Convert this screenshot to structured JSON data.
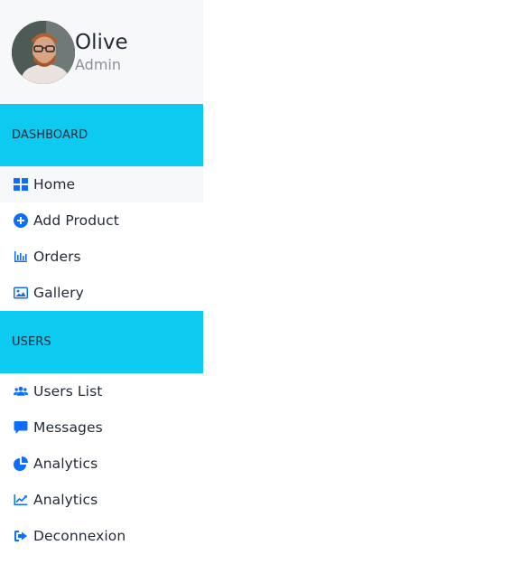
{
  "profile": {
    "name": "Olive",
    "role": "Admin"
  },
  "sections": {
    "dashboard": {
      "title": "DASHBOARD",
      "items": [
        {
          "label": "Home",
          "icon": "grid-icon"
        },
        {
          "label": "Add Product",
          "icon": "plus-circle-icon"
        },
        {
          "label": "Orders",
          "icon": "bar-chart-icon"
        },
        {
          "label": "Gallery",
          "icon": "image-icon"
        }
      ]
    },
    "users": {
      "title": "USERS",
      "items": [
        {
          "label": "Users List",
          "icon": "users-icon"
        },
        {
          "label": "Messages",
          "icon": "message-icon"
        },
        {
          "label": "Analytics",
          "icon": "pie-chart-icon"
        },
        {
          "label": "Analytics",
          "icon": "line-chart-icon"
        },
        {
          "label": "Deconnexion",
          "icon": "logout-icon"
        }
      ]
    }
  },
  "colors": {
    "accent": "#0dcaf0",
    "icon": "#0d6efd",
    "text": "#1f2937",
    "muted": "#8a909a",
    "panel": "#f7f8fa"
  }
}
